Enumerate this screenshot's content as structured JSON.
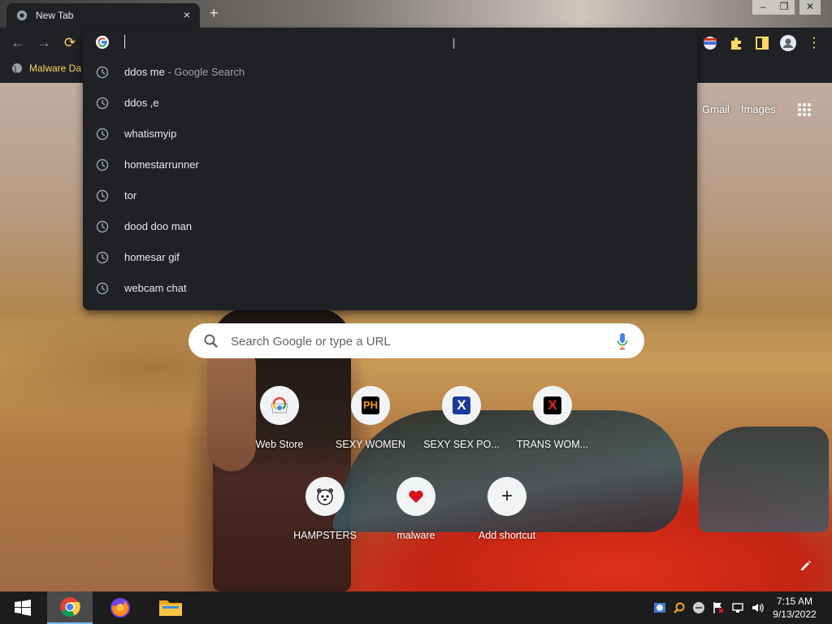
{
  "browser": {
    "tab_title": "New Tab",
    "tab_close": "×",
    "new_tab": "+",
    "window_controls": {
      "minimize": "–",
      "maximize": "❐",
      "close": "✕"
    },
    "nav": {
      "back": "←",
      "forward": "→",
      "reload": "⟳"
    },
    "menu": "⋮"
  },
  "bookmarks": [
    {
      "label": "Malware Da"
    }
  ],
  "omnibox": {
    "value": "",
    "suggestions": [
      {
        "text": "ddos me",
        "sub": " - Google Search"
      },
      {
        "text": "ddos ,e",
        "sub": ""
      },
      {
        "text": "whatismyip",
        "sub": ""
      },
      {
        "text": "homestarrunner",
        "sub": ""
      },
      {
        "text": "tor",
        "sub": ""
      },
      {
        "text": "dood doo man",
        "sub": ""
      },
      {
        "text": "homesar gif",
        "sub": ""
      },
      {
        "text": "webcam chat",
        "sub": ""
      }
    ]
  },
  "ntp": {
    "links": {
      "gmail": "Gmail",
      "images": "Images"
    },
    "search_placeholder": "Search Google or type a URL",
    "shortcuts": [
      {
        "label": "Web Store",
        "icon": "web-store-icon"
      },
      {
        "label": "SEXY WOMEN",
        "icon": "PH"
      },
      {
        "label": "SEXY SEX PO...",
        "icon": "X"
      },
      {
        "label": "TRANS WOM...",
        "icon": "X"
      },
      {
        "label": "HAMPSTERS",
        "icon": "hamster-icon"
      },
      {
        "label": "malware",
        "icon": "heart-icon"
      },
      {
        "label": "Add shortcut",
        "icon": "+"
      }
    ]
  },
  "taskbar": {
    "time": "7:15 AM",
    "date": "9/13/2022"
  },
  "colors": {
    "chrome_dark": "#202124",
    "bookmark_text": "#fdd663",
    "taskbar": "#1c1c1c"
  }
}
